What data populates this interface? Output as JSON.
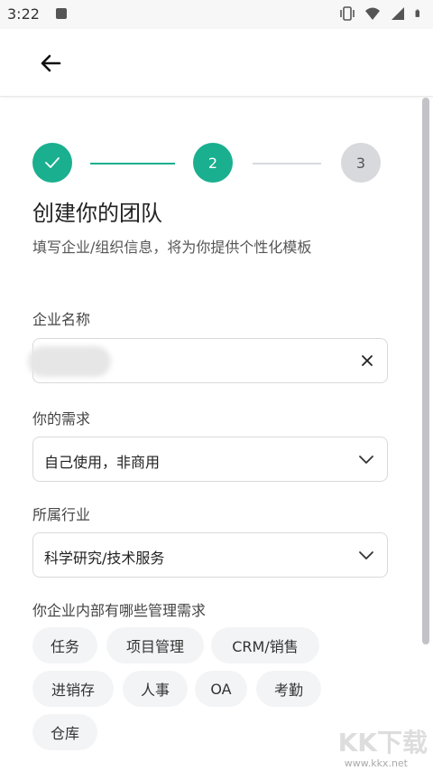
{
  "status_bar": {
    "time": "3:22"
  },
  "header": {
    "back_icon": "arrow-left-icon"
  },
  "stepper": {
    "current_step": 2,
    "steps": [
      {
        "state": "done",
        "icon": "check-icon"
      },
      {
        "label": "2",
        "state": "active"
      },
      {
        "label": "3",
        "state": "pending"
      }
    ],
    "colors": {
      "active": "#1aaf8f",
      "inactive": "#d7d9dc"
    }
  },
  "page": {
    "title": "创建你的团队",
    "subtitle": "填写企业/组织信息，将为你提供个性化模板"
  },
  "form": {
    "company_name": {
      "label": "企业名称",
      "value": ""
    },
    "needs": {
      "label": "你的需求",
      "value": "自己使用，非商用"
    },
    "industry": {
      "label": "所属行业",
      "value": "科学研究/技术服务"
    },
    "management": {
      "label": "你企业内部有哪些管理需求",
      "options": [
        "任务",
        "项目管理",
        "CRM/销售",
        "进销存",
        "人事",
        "OA",
        "考勤",
        "仓库"
      ]
    }
  },
  "watermark": {
    "text": "KK下载",
    "url": "www.kkx.net"
  }
}
